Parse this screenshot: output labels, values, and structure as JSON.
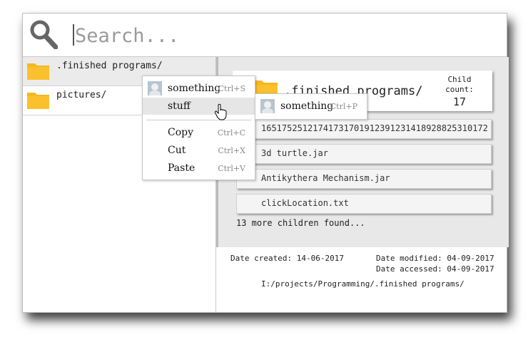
{
  "search": {
    "placeholder": "Search..."
  },
  "left": {
    "items": [
      {
        "label": ".finished programs/"
      },
      {
        "label": "pictures/"
      }
    ]
  },
  "folder": {
    "title": ".finished programs/",
    "child_count_label": "Child count:",
    "child_count": "17"
  },
  "children": [
    {
      "label": "16517525121741731701912391231418928825310172"
    },
    {
      "label": "3d turtle.jar"
    },
    {
      "label": "Antikythera Mechanism.jar"
    },
    {
      "label": "clickLocation.txt"
    }
  ],
  "more_text": "13 more children found...",
  "info": {
    "created": "Date created: 14-06-2017",
    "modified": "Date modified: 04-09-2017",
    "accessed": "Date accessed: 04-09-2017",
    "path": "I:/projects/Programming/.finished programs/"
  },
  "context_menu": {
    "items": [
      {
        "label": "something",
        "shortcut": "Ctrl+S"
      },
      {
        "label": "stuff",
        "shortcut": ""
      },
      {
        "label": "Copy",
        "shortcut": "Ctrl+C"
      },
      {
        "label": "Cut",
        "shortcut": "Ctrl+X"
      },
      {
        "label": "Paste",
        "shortcut": "Ctrl+V"
      }
    ]
  },
  "submenu": {
    "items": [
      {
        "label": "something",
        "shortcut": "Ctrl+P"
      }
    ]
  },
  "colors": {
    "folder": "#fbc02d",
    "folder_tab": "#f5b820"
  },
  "icons": [
    "search-icon",
    "folder-icon",
    "avatar-icon",
    "hand-cursor-icon"
  ]
}
